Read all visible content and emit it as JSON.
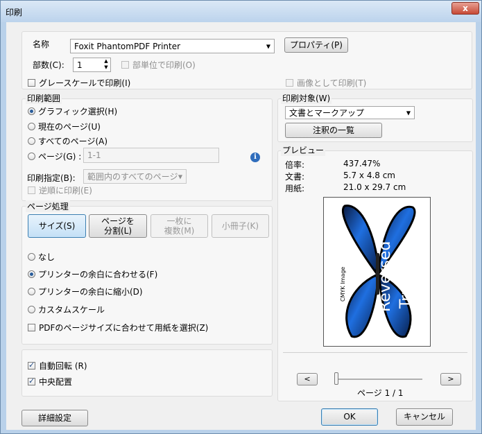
{
  "window": {
    "title": "印刷",
    "close_symbol": "x"
  },
  "printer": {
    "name_label": "名称",
    "name_value": "Foxit PhantomPDF Printer",
    "properties_button": "プロパティ(P)",
    "copies_label": "部数(C):",
    "copies_value": "1",
    "collate_label": "部単位で印刷(O)",
    "grayscale_label": "グレースケールで印刷(I)",
    "print_as_image_label": "画像として印刷(T)"
  },
  "print_range": {
    "title": "印刷範囲",
    "options": [
      "グラフィック選択(H)",
      "現在のページ(U)",
      "すべてのページ(A)",
      "ページ(G) :"
    ],
    "pages_value": "1-1",
    "subset_label": "印刷指定(B):",
    "subset_value": "範囲内のすべてのページ",
    "reverse_label": "逆順に印刷(E)"
  },
  "page_handling": {
    "title": "ページ処理",
    "buttons": {
      "size": "サイズ(S)",
      "split_line1": "ページを",
      "split_line2": "分割(L)",
      "multi_line1": "一枚に",
      "multi_line2": "複数(M)",
      "booklet": "小冊子(K)"
    },
    "options": [
      "なし",
      "プリンターの余白に合わせる(F)",
      "プリンターの余白に縮小(D)",
      "カスタムスケール"
    ],
    "choose_paper_label": "PDFのページサイズに合わせて用紙を選択(Z)"
  },
  "auto_rotate_label": "自動回転 (R)",
  "auto_center_label": "中央配置",
  "print_what": {
    "title": "印刷対象(W)",
    "value": "文書とマークアップ",
    "summarize_button": "注釈の一覧"
  },
  "preview": {
    "title": "プレビュー",
    "zoom_label": "倍率:",
    "zoom_value": "437.47%",
    "document_label": "文書:",
    "document_value": "5.7 x 4.8 cm",
    "paper_label": "用紙:",
    "paper_value": "21.0 x 29.7 cm",
    "image_caption": "CMYK Image",
    "wing_text_1": "Reversed",
    "wing_text_2": "Truetype",
    "prev_symbol": "<",
    "next_symbol": ">",
    "page_indicator": "ページ 1 / 1"
  },
  "footer": {
    "advanced_button": "詳細設定",
    "ok_button": "OK",
    "cancel_button": "キャンセル"
  }
}
